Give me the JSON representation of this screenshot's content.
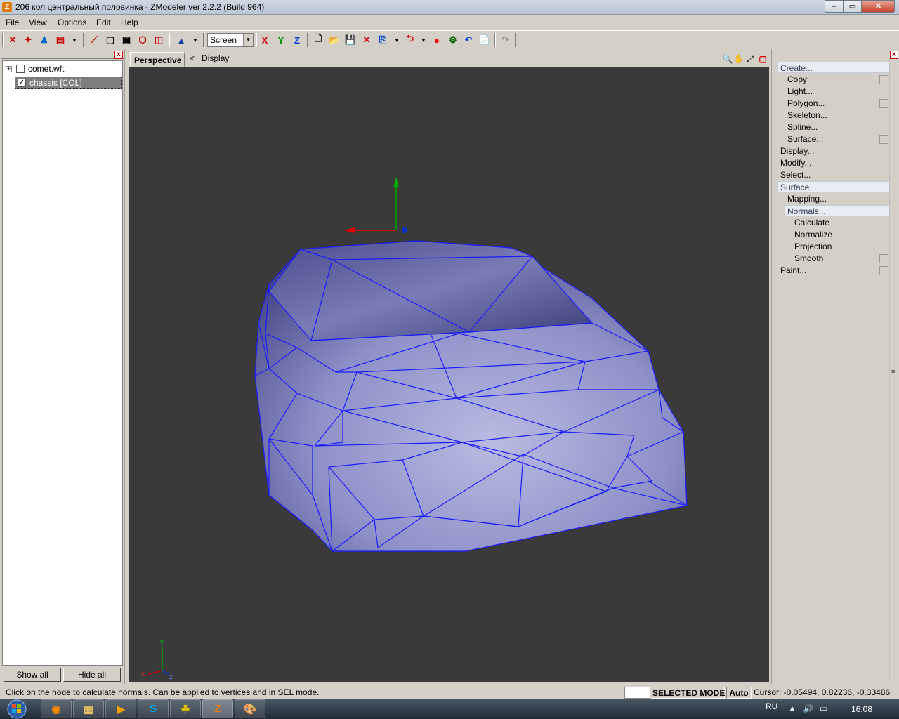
{
  "window": {
    "app_icon": "Z",
    "title": "206 кол центральный половинка - ZModeler ver 2.2.2 (Build 964)",
    "minimize": "–",
    "maximize": "▭",
    "close": "✕"
  },
  "menu": {
    "file": "File",
    "view": "View",
    "options": "Options",
    "edit": "Edit",
    "help": "Help"
  },
  "toolbar": {
    "view_mode": "Screen",
    "axis_x": "X",
    "axis_y": "Y",
    "axis_z": "Z"
  },
  "left_panel": {
    "close": "x",
    "tree": [
      {
        "label": "comet.wft",
        "expander": "+",
        "checked": false
      },
      {
        "label": "chassis [COL]",
        "checked": true
      }
    ],
    "show_all": "Show all",
    "hide_all": "Hide all"
  },
  "viewport": {
    "tab": "Perspective",
    "back": "<",
    "crumb": "Display",
    "axes_labels": {
      "x": "x",
      "y": "y",
      "z": "z"
    }
  },
  "right_panel": {
    "close": "x",
    "items": [
      {
        "label": "Create...",
        "level": 0,
        "highlight": true,
        "box": false
      },
      {
        "label": "Copy",
        "level": 1,
        "highlight": false,
        "box": true
      },
      {
        "label": "Light...",
        "level": 1,
        "highlight": false,
        "box": false
      },
      {
        "label": "Polygon...",
        "level": 1,
        "highlight": false,
        "box": true
      },
      {
        "label": "Skeleton...",
        "level": 1,
        "highlight": false,
        "box": false
      },
      {
        "label": "Spline...",
        "level": 1,
        "highlight": false,
        "box": false
      },
      {
        "label": "Surface...",
        "level": 1,
        "highlight": false,
        "box": true
      },
      {
        "label": "Display...",
        "level": 0,
        "highlight": false,
        "box": false
      },
      {
        "label": "Modify...",
        "level": 0,
        "highlight": false,
        "box": false
      },
      {
        "label": "Select...",
        "level": 0,
        "highlight": false,
        "box": false
      },
      {
        "label": "Surface...",
        "level": 0,
        "highlight": true,
        "box": false
      },
      {
        "label": "Mapping...",
        "level": 1,
        "highlight": false,
        "box": false
      },
      {
        "label": "Normals...",
        "level": 1,
        "highlight": true,
        "box": false
      },
      {
        "label": "Calculate",
        "level": 2,
        "highlight": false,
        "box": false
      },
      {
        "label": "Normalize",
        "level": 2,
        "highlight": false,
        "box": false
      },
      {
        "label": "Projection",
        "level": 2,
        "highlight": false,
        "box": false
      },
      {
        "label": "Smooth",
        "level": 2,
        "highlight": false,
        "box": true
      },
      {
        "label": "Paint...",
        "level": 0,
        "highlight": false,
        "box": true
      }
    ]
  },
  "status": {
    "hint": "Click on the node to calculate normals. Can be applied to vertices and in SEL mode.",
    "mode": "SELECTED MODE",
    "auto": "Auto",
    "cursor": "Cursor: -0.05494, 0.82236, -0.33486"
  },
  "taskbar": {
    "lang": "RU",
    "time": "16:08",
    "apps": [
      "firefox-icon",
      "explorer-icon",
      "media-player-icon",
      "skype-icon",
      "plugin-icon",
      "zmodeler-icon",
      "paint-icon"
    ]
  },
  "colors": {
    "viewport_bg": "#3a3a3a",
    "wireframe": "#1a1aff",
    "mesh_fill": "#8e90c8"
  }
}
